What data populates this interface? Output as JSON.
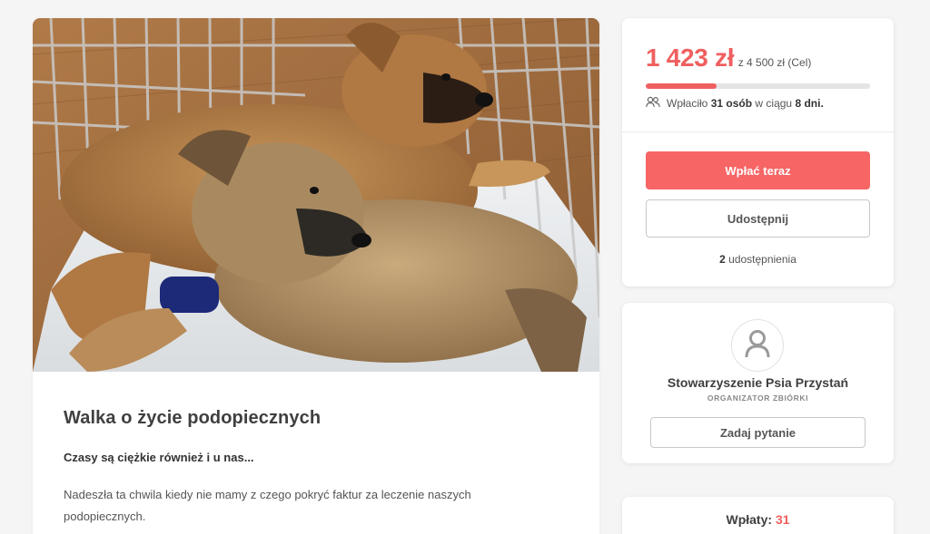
{
  "campaign": {
    "title": "Walka o życie podopiecznych",
    "lead": "Czasy są ciężkie również i u nas...",
    "body": "Nadeszła ta chwila kiedy nie mamy z czego pokryć faktur za leczenie naszych podopiecznych.",
    "photo_icon": "puppies-photo"
  },
  "donation": {
    "raised": "1 423 zł",
    "goal": "z 4 500 zł (Cel)",
    "progress_fraction": 0.316,
    "supporters_prefix": "Wpłaciło",
    "supporters_count": "31 osób",
    "supporters_mid": "w ciągu",
    "supporters_days": "8 dni.",
    "donate_button": "Wpłać teraz",
    "share_button": "Udostępnij",
    "shares_count": "2",
    "shares_label": "udostępnienia",
    "accent_color": "#f05f5f"
  },
  "organizer": {
    "name": "Stowarzyszenie Psia Przystań",
    "role": "ORGANIZATOR ZBIÓRKI",
    "ask_button": "Zadaj pytanie",
    "avatar_icon": "user-icon"
  },
  "payments": {
    "label": "Wpłaty:",
    "count": "31"
  }
}
